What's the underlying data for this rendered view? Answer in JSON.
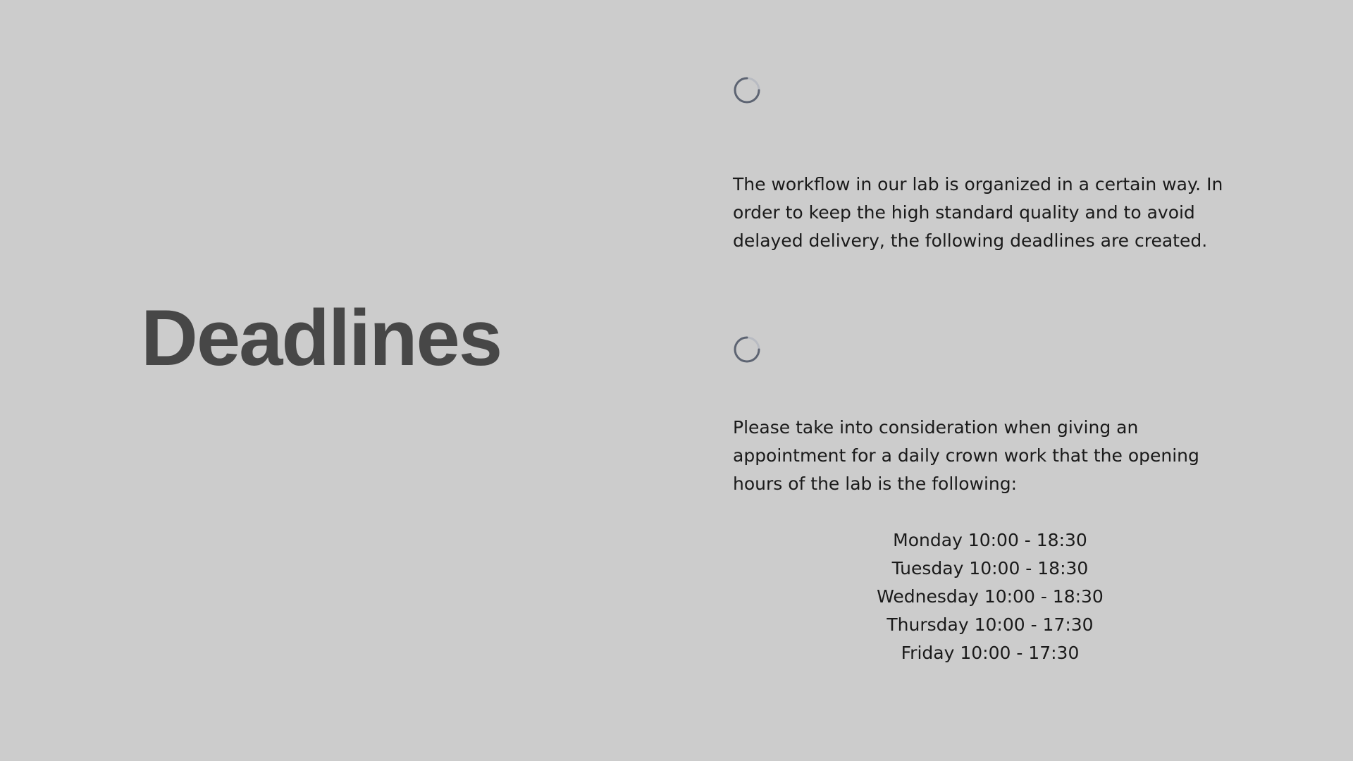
{
  "title": "Deadlines",
  "paragraph_1": "The workflow in our lab is organized in a certain way. In order to keep the high standard quality and to avoid delayed delivery, the following deadlines are created.",
  "paragraph_2": "Please take into consideration when giving an appointment for a daily crown work that the opening hours of the lab is the following:",
  "opening_hours": [
    "Monday 10:00 - 18:30",
    "Tuesday 10:00 - 18:30",
    "Wednesday 10:00 - 18:30",
    "Thursday 10:00 - 17:30",
    "Friday 10:00 - 17:30"
  ],
  "icons": {
    "spinner_1": "loading-spinner-icon",
    "spinner_2": "loading-spinner-icon"
  },
  "colors": {
    "background": "#cccccc",
    "title": "#474747",
    "text": "#1a1a1a",
    "spinner": "#5d6472"
  }
}
